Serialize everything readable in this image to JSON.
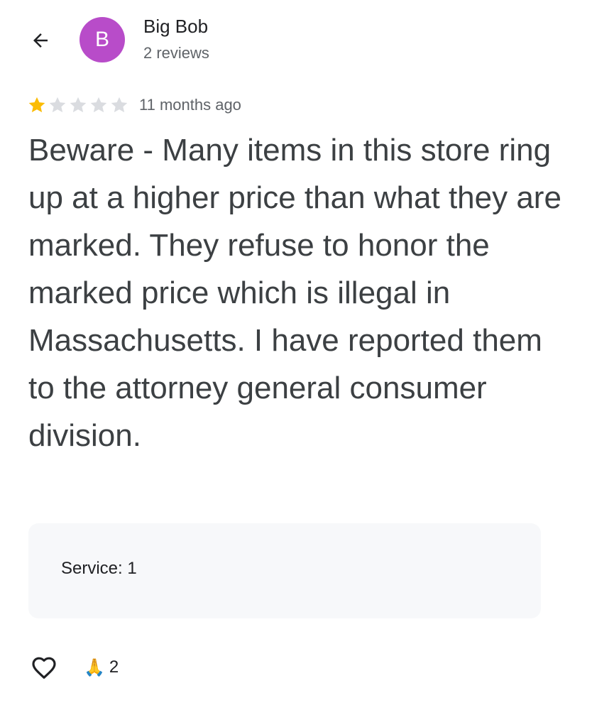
{
  "header": {
    "back_icon": "arrow-left-icon",
    "avatar_letter": "B",
    "avatar_color": "#b84cc9",
    "author_name": "Big Bob",
    "author_reviews": "2 reviews"
  },
  "review": {
    "rating": 1,
    "max_rating": 5,
    "star_filled_color": "#fbbc04",
    "star_empty_color": "#dadce0",
    "time": "11 months ago",
    "text": "Beware - Many items in this store ring up at a higher price than what they are marked. They refuse to honor the marked price which is illegal in Massachusetts. I have reported them to the attorney general consumer division.",
    "attributes": {
      "service_label": "Service: 1"
    }
  },
  "actions": {
    "like_icon": "heart-outline-icon",
    "reaction_emoji": "🙏",
    "reaction_count": "2"
  }
}
